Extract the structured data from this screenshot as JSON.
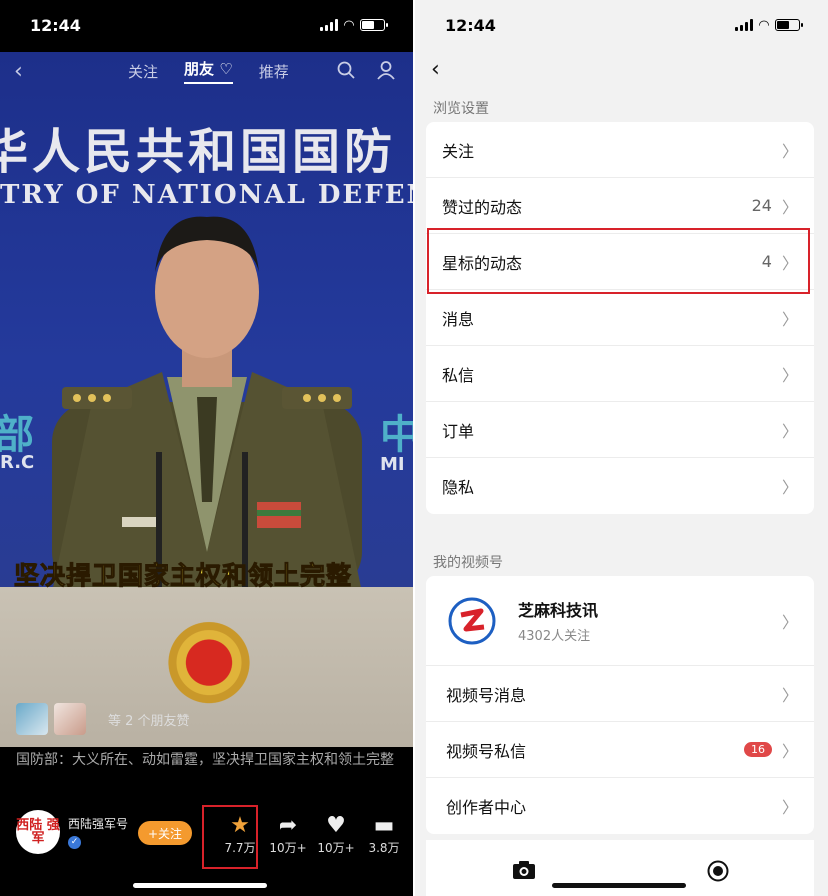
{
  "status": {
    "time": "12:44"
  },
  "left": {
    "nav": {
      "back": "‹",
      "tabs": [
        "关注",
        "朋友",
        "推荐"
      ],
      "active_tab_heart": "♡"
    },
    "video": {
      "banner_cn": "华人民共和国国防",
      "banner_en": "TRY OF NATIONAL DEFENSE",
      "side_left": "部",
      "side_right": "中",
      "side_left_small": "R.C",
      "side_right_small": "MI",
      "caption": "坚决捍卫国家主权和领土完整"
    },
    "likes_text": "等 2 个朋友赞",
    "description": "国防部：大义所在、动如雷霆，坚决捍卫国家主权和领土完整",
    "author": {
      "logo_text": "西陆 强军",
      "name": "西陆强军号",
      "follow_label": "+关注"
    },
    "actions": [
      {
        "icon": "★",
        "count": "7.7万"
      },
      {
        "icon": "➦",
        "count": "10万+"
      },
      {
        "icon": "♥",
        "count": "10万+"
      },
      {
        "icon": "▬",
        "count": "3.8万"
      }
    ],
    "colors": {
      "accent": "#f49a2e",
      "caption": "#f7e23b",
      "highlight": "#d8222a"
    }
  },
  "right": {
    "back": "‹",
    "section1": "浏览设置",
    "rows": [
      {
        "label": "关注",
        "value": ""
      },
      {
        "label": "赞过的动态",
        "value": "24"
      },
      {
        "label": "星标的动态",
        "value": "4"
      },
      {
        "label": "消息",
        "value": ""
      },
      {
        "label": "私信",
        "value": ""
      },
      {
        "label": "订单",
        "value": ""
      },
      {
        "label": "隐私",
        "value": ""
      }
    ],
    "section2": "我的视频号",
    "channel": {
      "name": "芝麻科技讯",
      "followers": "4302人关注"
    },
    "channel_rows": [
      {
        "label": "视频号消息",
        "badge": ""
      },
      {
        "label": "视频号私信",
        "badge": "16"
      },
      {
        "label": "创作者中心",
        "badge": ""
      }
    ],
    "bottom": [
      {
        "icon": "camera-icon"
      },
      {
        "icon": "live-icon"
      }
    ]
  }
}
